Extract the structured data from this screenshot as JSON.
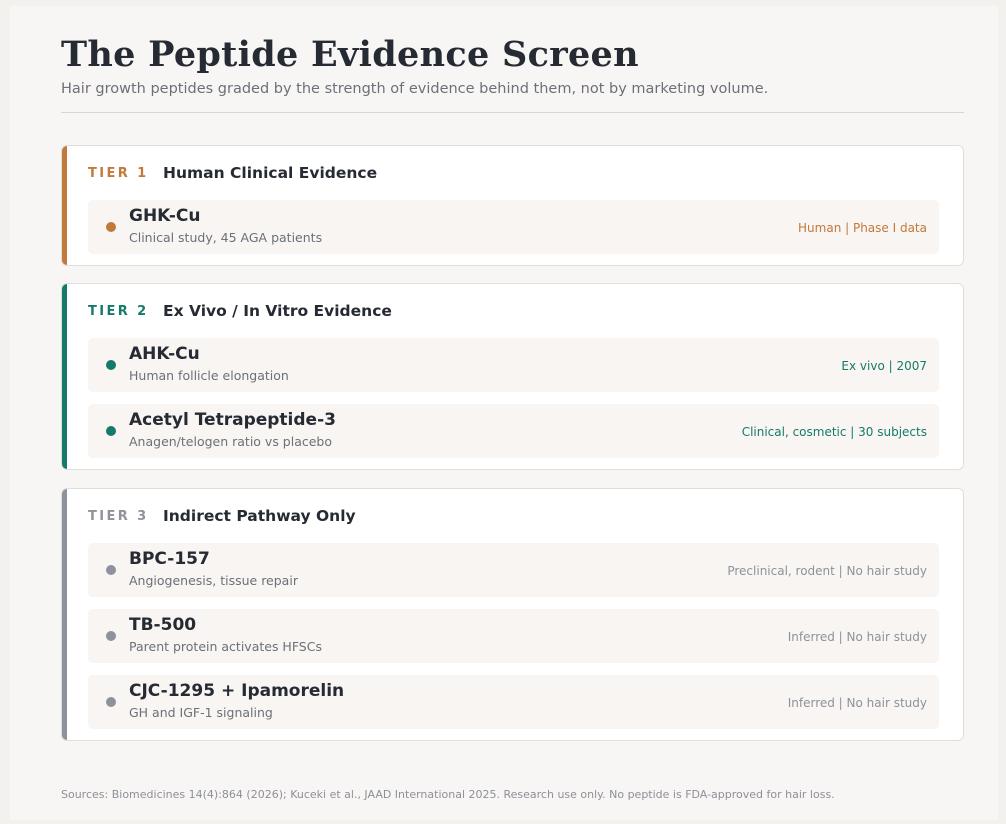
{
  "header": {
    "title": "The Peptide Evidence Screen",
    "subtitle": "Hair growth peptides graded by the strength of evidence behind them, not by marketing volume."
  },
  "colors": {
    "tier1": "#c17a3c",
    "tier2": "#167a6a",
    "tier3": "#8d929c"
  },
  "tiers": [
    {
      "label": "TIER 1",
      "name": "Human Clinical Evidence",
      "items": [
        {
          "name": "GHK-Cu",
          "desc": "Clinical study, 45 AGA patients",
          "meta": "Human | Phase I data"
        }
      ]
    },
    {
      "label": "TIER 2",
      "name": "Ex Vivo / In Vitro Evidence",
      "items": [
        {
          "name": "AHK-Cu",
          "desc": "Human follicle elongation",
          "meta": "Ex vivo | 2007"
        },
        {
          "name": "Acetyl Tetrapeptide-3",
          "desc": "Anagen/telogen ratio vs placebo",
          "meta": "Clinical, cosmetic | 30 subjects"
        }
      ]
    },
    {
      "label": "TIER 3",
      "name": "Indirect Pathway Only",
      "items": [
        {
          "name": "BPC-157",
          "desc": "Angiogenesis, tissue repair",
          "meta": "Preclinical, rodent | No hair study"
        },
        {
          "name": "TB-500",
          "desc": "Parent protein activates HFSCs",
          "meta": "Inferred | No hair study"
        },
        {
          "name": "CJC-1295 + Ipamorelin",
          "desc": "GH and IGF-1 signaling",
          "meta": "Inferred | No hair study"
        }
      ]
    }
  ],
  "footer": {
    "sources": "Sources: Biomedicines 14(4):864 (2026); Kuceki et al., JAAD International 2025. Research use only. No peptide is FDA-approved for hair loss."
  }
}
